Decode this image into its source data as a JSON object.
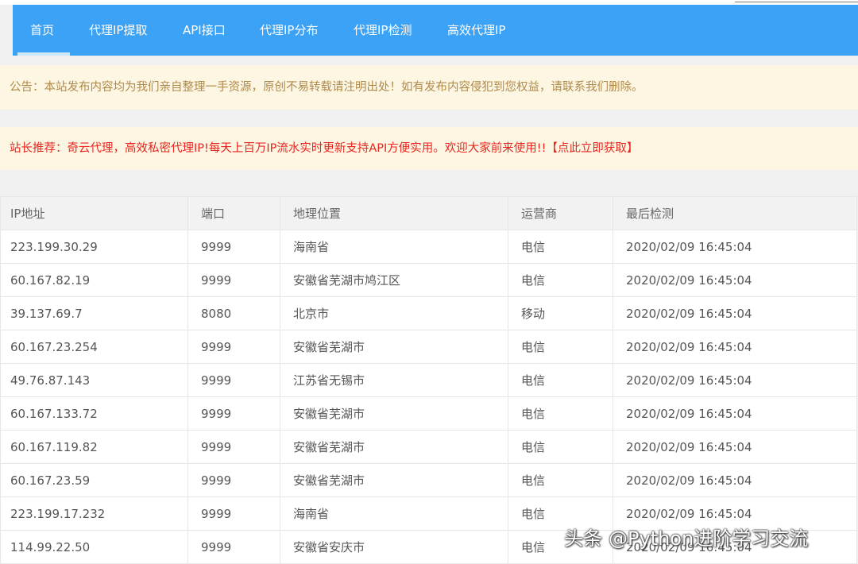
{
  "nav": {
    "items": [
      {
        "label": "首页",
        "active": true
      },
      {
        "label": "代理IP提取"
      },
      {
        "label": "API接口"
      },
      {
        "label": "代理IP分布"
      },
      {
        "label": "代理IP检测"
      },
      {
        "label": "高效代理IP"
      }
    ]
  },
  "notice": {
    "text": "公告：本站发布内容均为我们亲自整理一手资源，原创不易转载请注明出处！如有发布内容侵犯到您权益，请联系我们删除。"
  },
  "recommend": {
    "text": "站长推荐：奇云代理，高效私密代理IP!每天上百万IP流水实时更新支持API方便实用。欢迎大家前来使用!!",
    "link": "【点此立即获取】"
  },
  "table": {
    "headers": [
      "IP地址",
      "端口",
      "地理位置",
      "运营商",
      "最后检测"
    ],
    "rows": [
      [
        "223.199.30.29",
        "9999",
        "海南省",
        "电信",
        "2020/02/09 16:45:04"
      ],
      [
        "60.167.82.19",
        "9999",
        "安徽省芜湖市鸠江区",
        "电信",
        "2020/02/09 16:45:04"
      ],
      [
        "39.137.69.7",
        "8080",
        "北京市",
        "移动",
        "2020/02/09 16:45:04"
      ],
      [
        "60.167.23.254",
        "9999",
        "安徽省芜湖市",
        "电信",
        "2020/02/09 16:45:04"
      ],
      [
        "49.76.87.143",
        "9999",
        "江苏省无锡市",
        "电信",
        "2020/02/09 16:45:04"
      ],
      [
        "60.167.133.72",
        "9999",
        "安徽省芜湖市",
        "电信",
        "2020/02/09 16:45:04"
      ],
      [
        "60.167.119.82",
        "9999",
        "安徽省芜湖市",
        "电信",
        "2020/02/09 16:45:04"
      ],
      [
        "60.167.23.59",
        "9999",
        "安徽省芜湖市",
        "电信",
        "2020/02/09 16:45:04"
      ],
      [
        "223.199.17.232",
        "9999",
        "海南省",
        "电信",
        "2020/02/09 16:45:04"
      ],
      [
        "114.99.22.50",
        "9999",
        "安徽省安庆市",
        "电信",
        "2020/02/09 16:45:04"
      ]
    ]
  },
  "watermark": {
    "prefix": "头条",
    "handle": "@Python进阶学习交流"
  },
  "colors": {
    "nav_bg": "#3ba2f5",
    "notice_text": "#b08a4a",
    "recommend_text": "#e8261f",
    "notice_bg": "#fdf6e3"
  }
}
